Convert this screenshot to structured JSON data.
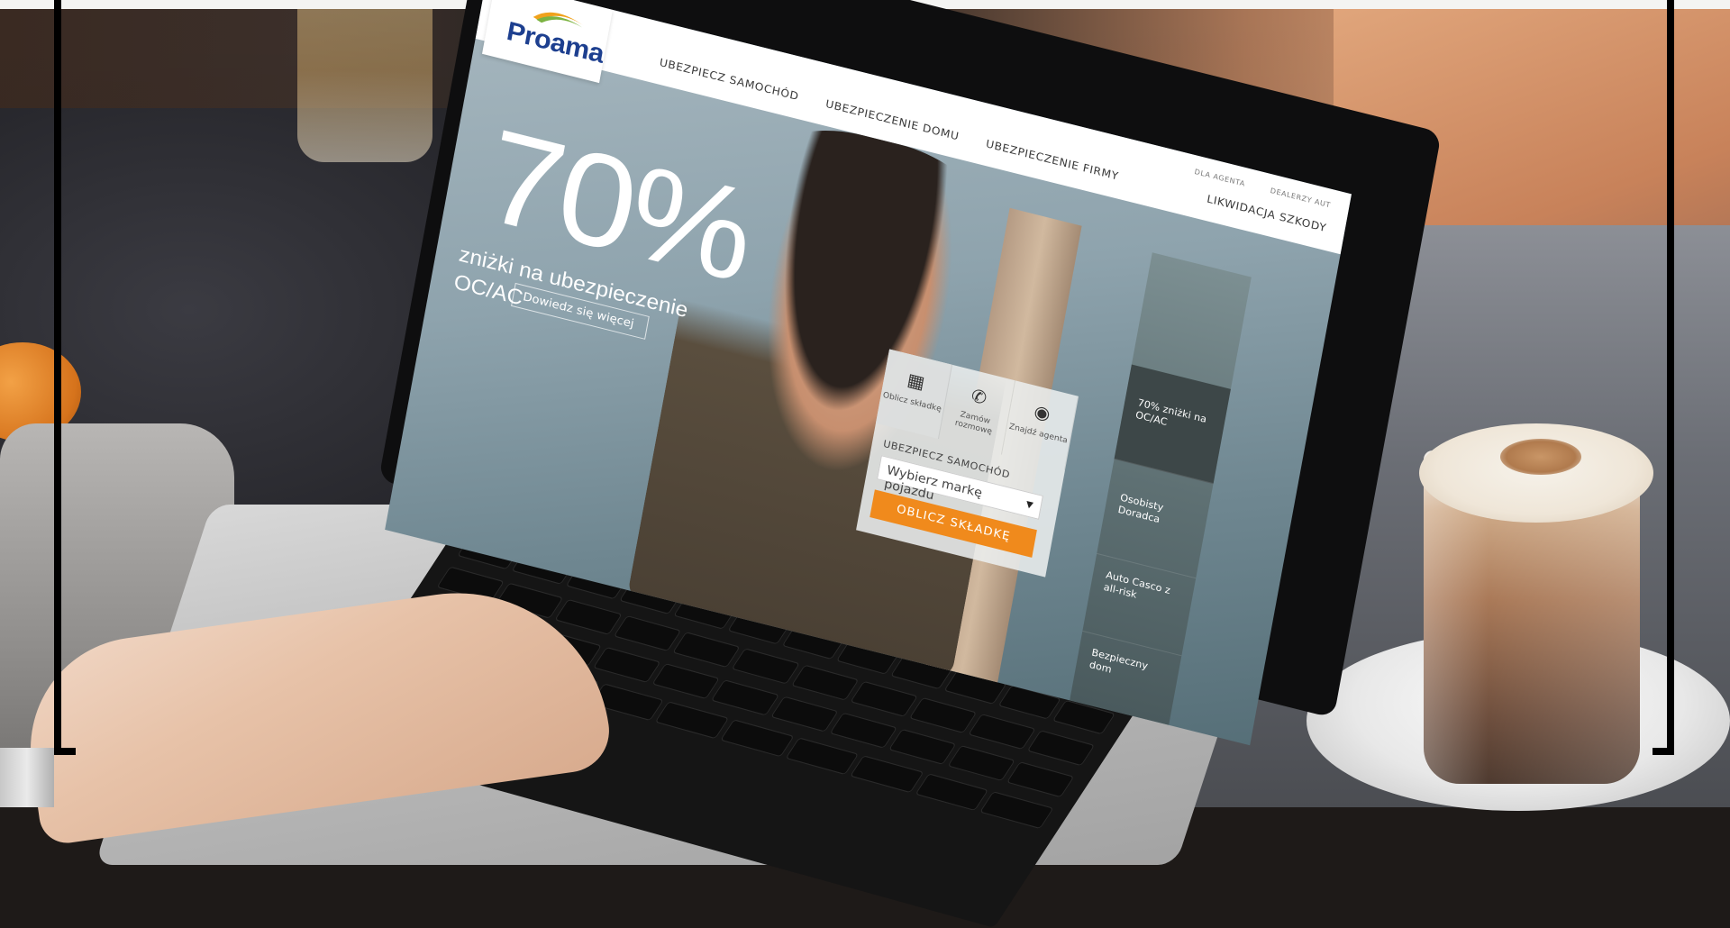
{
  "site": {
    "logo_text": "Proama",
    "nav": [
      "UBEZPIECZ SAMOCHÓD",
      "UBEZPIECZENIE DOMU",
      "UBEZPIECZENIE FIRMY"
    ],
    "nav_small": [
      "DLA AGENTA",
      "DEALERZY AUT"
    ],
    "nav_right": "LIKWIDACJA SZKODY"
  },
  "hero": {
    "percent": "70%",
    "line1": "zniżki na ubezpieczenie",
    "line2": "OC/AC",
    "cta": "Dowiedz się więcej"
  },
  "widget": {
    "tabs": [
      {
        "label": "Oblicz składkę",
        "icon": "calculator-icon"
      },
      {
        "label": "Zamów rozmowę",
        "icon": "phone-icon"
      },
      {
        "label": "Znajdź agenta",
        "icon": "agent-search-icon"
      }
    ],
    "label": "UBEZPIECZ SAMOCHÓD",
    "select_value": "Wybierz markę pojazdu",
    "button": "OBLICZ SKŁADKĘ"
  },
  "rail": [
    "70% zniżki na OC/AC",
    "Osobisty Doradca",
    "Auto Casco z all-risk",
    "Bezpieczny dom"
  ],
  "colors": {
    "brand_blue": "#1d3f8f",
    "brand_orange": "#f08a1c"
  }
}
